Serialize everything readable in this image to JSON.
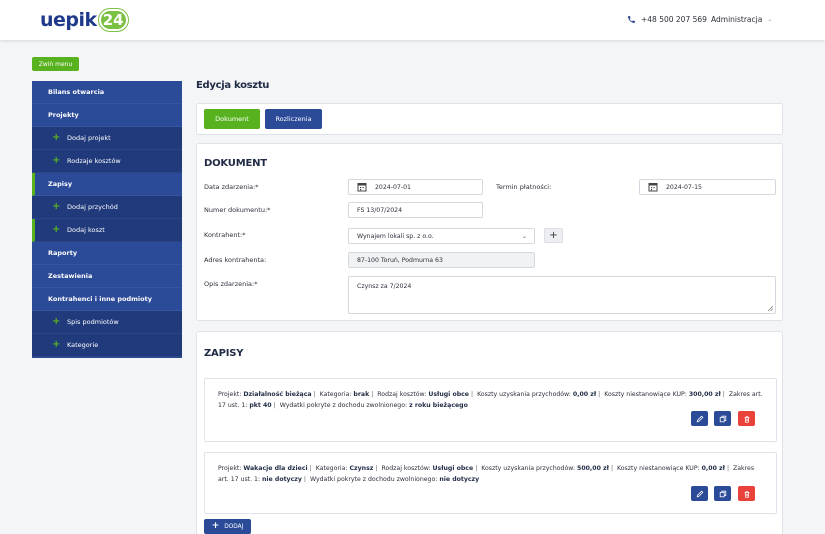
{
  "header": {
    "logo_text": "uepik",
    "logo_badge": "24",
    "phone": "+48 500 207 569",
    "user_menu": "Administracja"
  },
  "menu_toggle": "Zwiń menu",
  "sidebar": {
    "items": [
      {
        "label": "Bilans otwarcia"
      },
      {
        "label": "Projekty"
      },
      {
        "label": "Dodaj projekt"
      },
      {
        "label": "Rodzaje kosztów"
      },
      {
        "label": "Zapisy"
      },
      {
        "label": "Dodaj przychód"
      },
      {
        "label": "Dodaj koszt"
      },
      {
        "label": "Raporty"
      },
      {
        "label": "Zestawienia"
      },
      {
        "label": "Kontrahenci i inne podmioty"
      },
      {
        "label": "Spis podmiotów"
      },
      {
        "label": "Kategorie"
      }
    ]
  },
  "page_title": "Edycja kosztu",
  "tabs": {
    "dokument": "Dokument",
    "rozliczenia": "Rozliczenia"
  },
  "dokument": {
    "title": "DOKUMENT",
    "data_zdarzenia_label": "Data zdarzenia:*",
    "data_zdarzenia_value": "2024-07-01",
    "termin_label": "Termin płatności:",
    "termin_value": "2024-07-15",
    "numer_label": "Numer dokumentu:*",
    "numer_value": "FS 13/07/2024",
    "kontrahent_label": "Kontrahent:*",
    "kontrahent_value": "Wynajem lokali sp. z o.o.",
    "adres_label": "Adres kontrahenta:",
    "adres_value": "87-100 Toruń, Podmurna 63",
    "opis_label": "Opis zdarzenia:*",
    "opis_value": "Czynsz za 7/2024"
  },
  "zapisy": {
    "title": "ZAPISY",
    "entries": [
      {
        "projekt_label": "Projekt:",
        "projekt": "Działalność bieżąca",
        "kategoria_label": "Kategoria:",
        "kategoria": "brak",
        "rodzaj_label": "Rodzaj kosztów:",
        "rodzaj": "Usługi obce",
        "koszty_label": "Koszty uzyskania przychodów:",
        "koszty": "0,00 zł",
        "kup_label": "Koszty niestanowiące KUP:",
        "kup": "300,00 zł",
        "zakres_label": "Zakres art. 17 ust. 1:",
        "zakres": "pkt 40",
        "wydatki_label": "Wydatki pokryte z dochodu zwolnionego:",
        "wydatki": "z roku bieżącego"
      },
      {
        "projekt_label": "Projekt:",
        "projekt": "Wakacje dla dzieci",
        "kategoria_label": "Kategoria:",
        "kategoria": "Czynsz",
        "rodzaj_label": "Rodzaj kosztów:",
        "rodzaj": "Usługi obce",
        "koszty_label": "Koszty uzyskania przychodów:",
        "koszty": "500,00 zł",
        "kup_label": "Koszty niestanowiące KUP:",
        "kup": "0,00 zł",
        "zakres_label": "Zakres art. 17 ust. 1:",
        "zakres": "nie dotyczy",
        "wydatki_label": "Wydatki pokryte z dochodu zwolnionego:",
        "wydatki": "nie dotyczy"
      }
    ],
    "add_label": "DODAJ"
  },
  "colors": {
    "primary": "#2b4a98",
    "accent": "#58b21f",
    "danger": "#e8423b"
  }
}
